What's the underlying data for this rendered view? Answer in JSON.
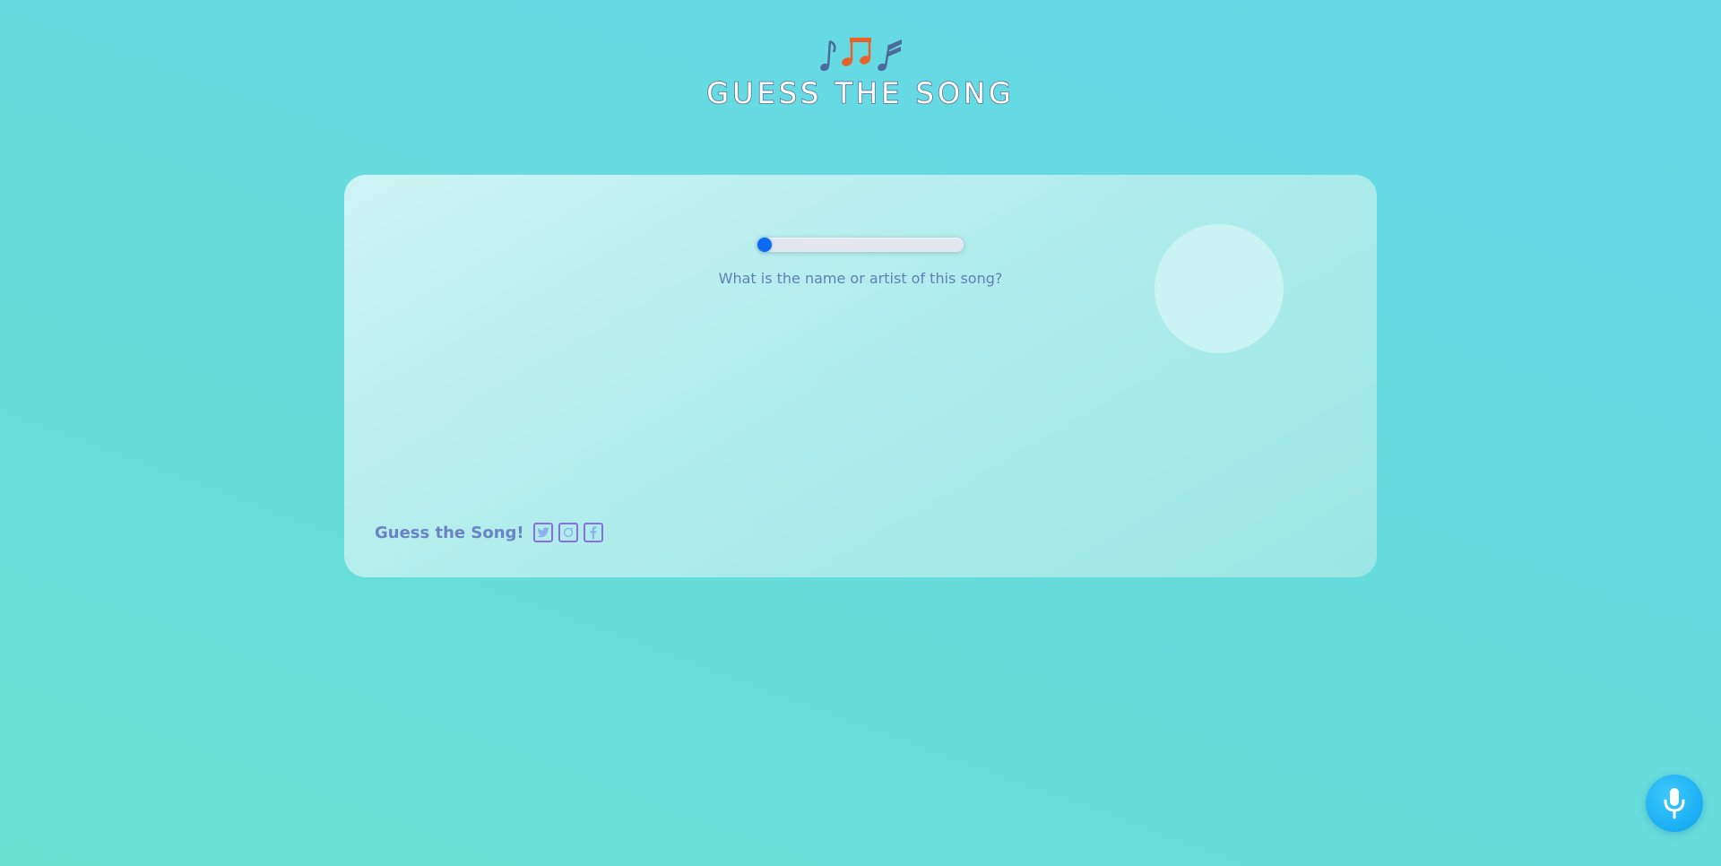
{
  "header": {
    "icon": "music-notes-icon",
    "title": "GUESS THE SONG"
  },
  "player": {
    "progress": 0,
    "question": "What is the name or artist of this song?"
  },
  "footer": {
    "text": "Guess the Song!",
    "social": [
      {
        "name": "twitter",
        "icon": "twitter-icon"
      },
      {
        "name": "instagram",
        "icon": "instagram-icon"
      },
      {
        "name": "facebook",
        "icon": "facebook-icon"
      }
    ]
  },
  "mic": {
    "icon": "microphone-icon"
  },
  "colors": {
    "background": "#67dcdc",
    "accent": "#0b6bf0",
    "text": "#5f7fb5",
    "social_border": "#8a6ee6",
    "mic": "#1aaef4",
    "note_orange": "#e8622a",
    "note_blue": "#4d6a9a"
  }
}
